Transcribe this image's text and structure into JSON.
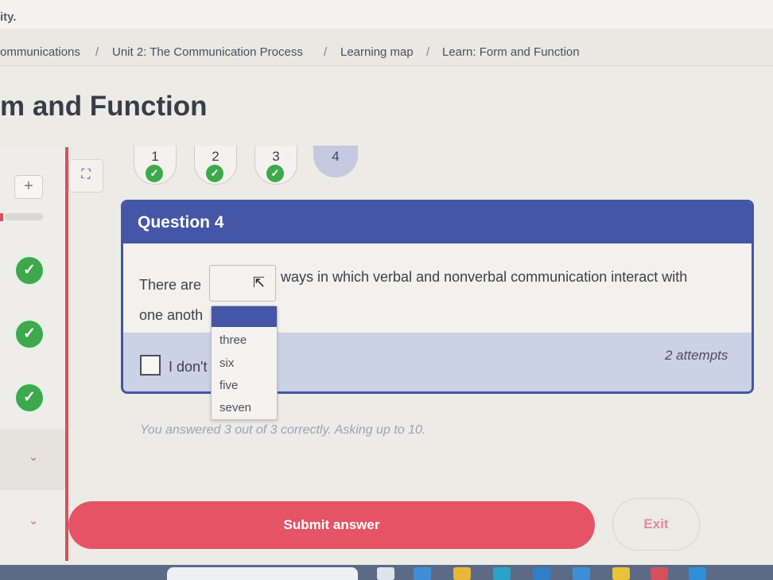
{
  "brand": {
    "text": "ity."
  },
  "breadcrumb": {
    "items": [
      "ommunications",
      "Unit 2: The Communication Process",
      "Learning map",
      "Learn: Form and Function"
    ],
    "separator": "/"
  },
  "page_title": "m and Function",
  "question_tabs": [
    {
      "number": "1",
      "completed": true
    },
    {
      "number": "2",
      "completed": true
    },
    {
      "number": "3",
      "completed": true
    },
    {
      "number": "4",
      "completed": false,
      "active": true
    }
  ],
  "question": {
    "header": "Question 4",
    "text_before": "There are",
    "text_after": "ways in which verbal and nonverbal communication interact with",
    "text_line2": "one anoth",
    "dropdown_options": [
      "",
      "three",
      "six",
      "five",
      "seven"
    ],
    "idk_label": "I don't",
    "attempts": "2 attempts"
  },
  "status_text": "You answered 3 out of 3 correctly. Asking up to 10.",
  "buttons": {
    "submit": "Submit answer",
    "exit": "Exit"
  },
  "icons": {
    "plus": "+",
    "check": "✓",
    "chevron": "‹",
    "expand": "⛶",
    "cursor": "⇱"
  },
  "colors": {
    "accent_blue": "#4456a5",
    "success_green": "#3ea84d",
    "submit_red": "#e45466",
    "panel_blue": "#cbd2e6"
  }
}
